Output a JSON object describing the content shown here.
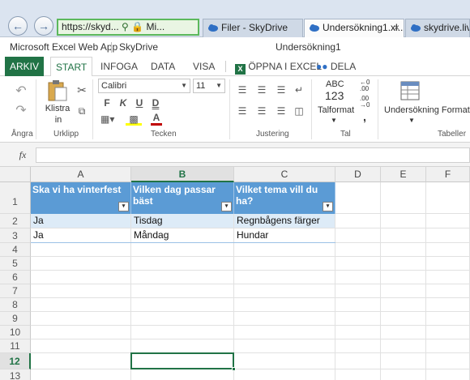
{
  "browser": {
    "back_icon": "arrow-left-icon",
    "forward_icon": "arrow-right-icon",
    "address_text": "https://skyd...",
    "address_site": "Mi...",
    "tabs": [
      {
        "label": "Filer - SkyDrive",
        "icon": "skydrive-cloud-icon"
      },
      {
        "label": "Undersökning1.xl...",
        "icon": "skydrive-cloud-icon",
        "active": true
      },
      {
        "label": "skydrive.live",
        "icon": "skydrive-cloud-icon"
      }
    ],
    "close_glyph": "×"
  },
  "app": {
    "name": "Microsoft Excel Web App",
    "service": "SkyDrive",
    "doc_title": "Undersökning1"
  },
  "ribbon_tabs": {
    "file": "ARKIV",
    "start": "START",
    "insert": "INFOGA",
    "data": "DATA",
    "view": "VISA",
    "open_excel": "ÖPPNA I EXCEL",
    "share": "DELA"
  },
  "ribbon": {
    "undo_group": "Ångra",
    "clipboard_group": "Urklipp",
    "paste_label_1": "Klistra",
    "paste_label_2": "in",
    "font_group": "Tecken",
    "font_name": "Calibri",
    "font_size": "11",
    "bold": "F",
    "italic": "K",
    "underline": "U",
    "double_underline": "D",
    "font_color_letter": "A",
    "align_group": "Justering",
    "number_group": "Tal",
    "number_format_icon_text_1": "ABC",
    "number_format_icon_text_2": "123",
    "number_format_label": "Talformat",
    "inc_decimal_1": "←0",
    "inc_decimal_2": ".00",
    "dec_decimal_1": ".00",
    "dec_decimal_2": "→0",
    "comma": ",",
    "table_group": "Tabeller",
    "table_format_label": "Undersökning Formate"
  },
  "formula_bar": {
    "fx": "fx",
    "value": ""
  },
  "colors": {
    "excel_green": "#217346",
    "table_header": "#5b9bd5",
    "table_band": "#ddebf7"
  },
  "sheet": {
    "columns": [
      "A",
      "B",
      "C",
      "D",
      "E",
      "F"
    ],
    "selected_column": "B",
    "rows": [
      "1",
      "2",
      "3",
      "4",
      "5",
      "6",
      "7",
      "8",
      "9",
      "10",
      "11",
      "12",
      "13"
    ],
    "selected_row": "12",
    "headers": [
      "Ska vi ha vinterfest",
      "Vilken dag passar bäst",
      "Vilket tema vill du ha?"
    ],
    "filter_glyph": "▾",
    "data": [
      [
        "Ja",
        "Tisdag",
        "Regnbågens färger"
      ],
      [
        "Ja",
        "Måndag",
        "Hundar"
      ]
    ]
  }
}
